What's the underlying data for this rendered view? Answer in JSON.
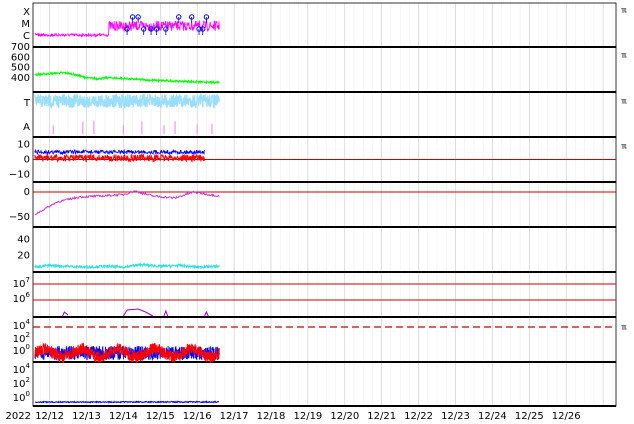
{
  "chart_data": {
    "type": "line",
    "x_start_label": "2022",
    "x_tick_labels": [
      "12/12",
      "12/13",
      "12/14",
      "12/15",
      "12/16",
      "12/17",
      "12/18",
      "12/19",
      "12/20",
      "12/21",
      "12/22",
      "12/23",
      "12/24",
      "12/25",
      "12/26"
    ],
    "x_range_days": [
      11.55,
      27.35
    ],
    "data_end_day": 16.6,
    "panel_marker": "ℼ",
    "panels": [
      {
        "id": "xray_class",
        "y_tick_labels": [
          "X",
          "M",
          "C"
        ],
        "series_color": "#ff00ff",
        "marker_color": "#0000ff",
        "marker_days": [
          14.1,
          14.25,
          14.4,
          14.55,
          14.75,
          14.9,
          15.15,
          15.5,
          15.85,
          16.05,
          16.15,
          16.25
        ],
        "marker_levels": [
          "C",
          "M",
          "M",
          "C",
          "C",
          "C",
          "C",
          "M",
          "M",
          "C",
          "C",
          "M"
        ]
      },
      {
        "id": "solar_wind_speed",
        "y_tick_labels": [
          "700",
          "600",
          "500",
          "400"
        ],
        "y_tick_values": [
          700,
          600,
          500,
          400
        ],
        "ylim": [
          300,
          700
        ],
        "series_color": "#00ff00",
        "series": [
          {
            "x": [
              11.6,
              12.0,
              12.4,
              12.7,
              13.0,
              13.3,
              13.6,
              13.9,
              14.3,
              14.8,
              15.2,
              15.6,
              16.0,
              16.3,
              16.6
            ],
            "values": [
              430,
              440,
              450,
              430,
              400,
              390,
              400,
              395,
              385,
              375,
              370,
              365,
              360,
              355,
              355
            ]
          }
        ]
      },
      {
        "id": "imf_bt_bz_marker",
        "y_tick_labels": [
          "T",
          "A"
        ],
        "series_colors": [
          "#99ddff",
          "#ee99ee"
        ]
      },
      {
        "id": "magnetic_field",
        "y_tick_labels": [
          "10",
          "0",
          "−10"
        ],
        "y_tick_values": [
          10,
          0,
          -10
        ],
        "ylim": [
          -15,
          15
        ],
        "reference_line": 0,
        "series_colors": [
          "#0000ff",
          "#ff0000"
        ]
      },
      {
        "id": "density_index",
        "y_tick_labels": [
          "0",
          "−50"
        ],
        "y_tick_values": [
          0,
          -50
        ],
        "ylim": [
          -70,
          20
        ],
        "reference_line": 0,
        "series_color": "#cc33cc",
        "series": [
          {
            "x": [
              11.6,
              12.2,
              12.8,
              13.4,
              14.0,
              14.3,
              14.8,
              15.4,
              15.9,
              16.3,
              16.6
            ],
            "values": [
              -45,
              -20,
              -10,
              -8,
              -5,
              2,
              -8,
              -12,
              0,
              -5,
              -8
            ]
          }
        ]
      },
      {
        "id": "temperature_index",
        "y_tick_labels": [
          "40",
          "20"
        ],
        "y_tick_values": [
          40,
          20
        ],
        "ylim": [
          0,
          55
        ],
        "series_color": "#33dddd",
        "series": [
          {
            "x": [
              11.6,
              12.0,
              12.5,
              13.0,
              13.5,
              14.0,
              14.5,
              15.0,
              15.5,
              16.0,
              16.6
            ],
            "values": [
              6,
              8,
              7,
              6,
              7,
              6,
              9,
              7,
              8,
              6,
              7
            ]
          }
        ]
      },
      {
        "id": "proton_flux",
        "y_tick_labels": [
          "10^7",
          "10^6"
        ],
        "reference_values": [
          "10^7",
          "10^6"
        ],
        "series_color": "#9900cc"
      },
      {
        "id": "electron_flux",
        "y_tick_labels": [
          "10^4",
          "10^2",
          "10^0"
        ],
        "threshold_label": "10^4",
        "series_colors": [
          "#0000ff",
          "#ff0000"
        ]
      },
      {
        "id": "neutron_flux",
        "y_tick_labels": [
          "10^4",
          "10^2",
          "10^0"
        ],
        "series_color": "#0000ff"
      }
    ]
  }
}
